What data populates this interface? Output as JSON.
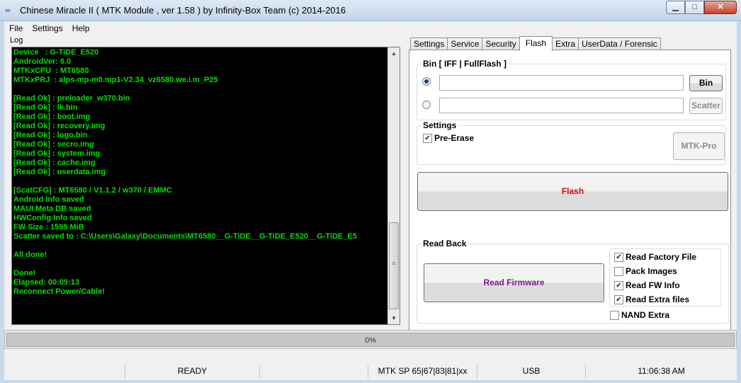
{
  "window": {
    "title": "Chinese Miracle II ( MTK Module , ver 1.58 ) by Infinity-Box Team (c) 2014-2016",
    "app_icon": "infinity-icon"
  },
  "menu": [
    "File",
    "Settings",
    "Help"
  ],
  "log": {
    "label": "Log",
    "lines": [
      "Device   : G-TiDE_E520",
      "AndroidVer: 6.0",
      "MTKxCPU  : MT6580",
      "MTKxPRJ  : alps-mp-m0.mp1-V2.34_vz6580.we.i.m_P25",
      "",
      "[Read Ok] : preloader_w370.bin",
      "[Read Ok] : lk.bin",
      "[Read Ok] : boot.img",
      "[Read Ok] : recovery.img",
      "[Read Ok] : logo.bin",
      "[Read Ok] : secro.img",
      "[Read Ok] : system.img",
      "[Read Ok] : cache.img",
      "[Read Ok] : userdata.img",
      "",
      "[ScatCFG] : MT6580 / V1.1.2 / w370 / EMMC",
      "Android Info saved",
      "MAUI Meta DB saved",
      "HWConfig Info saved",
      "FW Size : 1595 MiB",
      "Scatter saved to : C:\\Users\\Galaxy\\Documents\\MT6580__G-TiDE__G-TiDE_E520__G-TiDE_E5",
      "",
      "All done!",
      "",
      "Done!",
      "Elapsed: 00:09:13",
      "Reconnect Power/Cable!"
    ],
    "text_color": "#00e000"
  },
  "tabs": [
    "Settings",
    "Service",
    "Security",
    "Flash",
    "Extra",
    "UserData / Forensic"
  ],
  "active_tab": "Flash",
  "flash": {
    "bin_group_title": "Bin  [ IFF | FullFlash ]",
    "bin_path_value": "",
    "scatter_path_value": "",
    "bin_button": "Bin",
    "scatter_button": "Scatter",
    "settings_title": "Settings",
    "pre_erase_label": "Pre-Erase",
    "pre_erase_checked": true,
    "mtk_pro_button": "MTK-Pro",
    "flash_button": "Flash",
    "flash_color": "#e00000",
    "readback_title": "Read Back",
    "read_firmware_button": "Read Firmware",
    "read_firmware_color": "#7a1a8c",
    "options": [
      {
        "label": "Read Factory File",
        "checked": true
      },
      {
        "label": "Pack Images",
        "checked": false
      },
      {
        "label": "Read FW Info",
        "checked": true
      },
      {
        "label": "Read Extra files",
        "checked": true
      }
    ],
    "nand_extra_label": "NAND Extra",
    "nand_extra_checked": false
  },
  "progress": {
    "percent_text": "0%",
    "fraction": 0
  },
  "statusbar": {
    "state": "READY",
    "chip": "MTK SP 65|67|83|81|xx",
    "port": "USB",
    "time": "11:06:38 AM"
  }
}
